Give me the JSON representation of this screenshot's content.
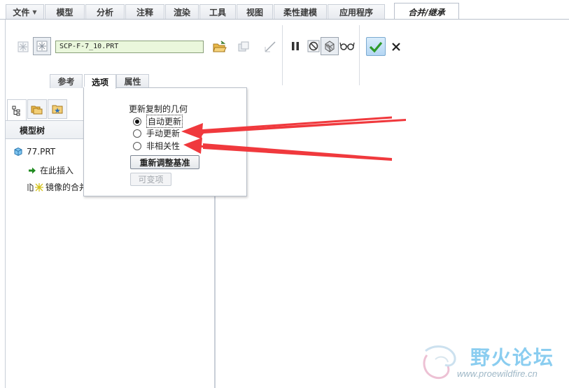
{
  "ribbon": {
    "tabs": [
      {
        "label": "文件"
      },
      {
        "label": "模型"
      },
      {
        "label": "分析"
      },
      {
        "label": "注释"
      },
      {
        "label": "渲染"
      },
      {
        "label": "工具"
      },
      {
        "label": "视图"
      },
      {
        "label": "柔性建模"
      },
      {
        "label": "应用程序"
      },
      {
        "label": "合并/继承"
      }
    ],
    "active_tab": "合并/继承",
    "reference_model": "SCP-F-7_10.PRT",
    "sub_tabs": [
      {
        "label": "参考"
      },
      {
        "label": "选项"
      },
      {
        "label": "属性"
      }
    ],
    "active_sub_tab": "选项"
  },
  "options_panel": {
    "title": "更新复制的几何",
    "options": [
      {
        "label": "自动更新",
        "selected": true
      },
      {
        "label": "手动更新",
        "selected": false
      },
      {
        "label": "非相关性",
        "selected": false
      }
    ],
    "realign_button": "重新调整基准",
    "variable_items_button": "可变项"
  },
  "navigator": {
    "header": "模型树",
    "tree": [
      {
        "label": "77.PRT",
        "icon": "part-icon"
      },
      {
        "label": "在此插入",
        "icon": "insert-here-arrow-icon"
      },
      {
        "label": "镜像的合并",
        "icon": "merge-feature-icon"
      }
    ]
  },
  "watermark": {
    "text": "野火论坛",
    "url": "www.proewildfire.cn"
  },
  "colors": {
    "annotation_arrow": "#f0393d",
    "reference_field_bg": "#eaf7dc",
    "watermark": "#7ec8ef"
  }
}
